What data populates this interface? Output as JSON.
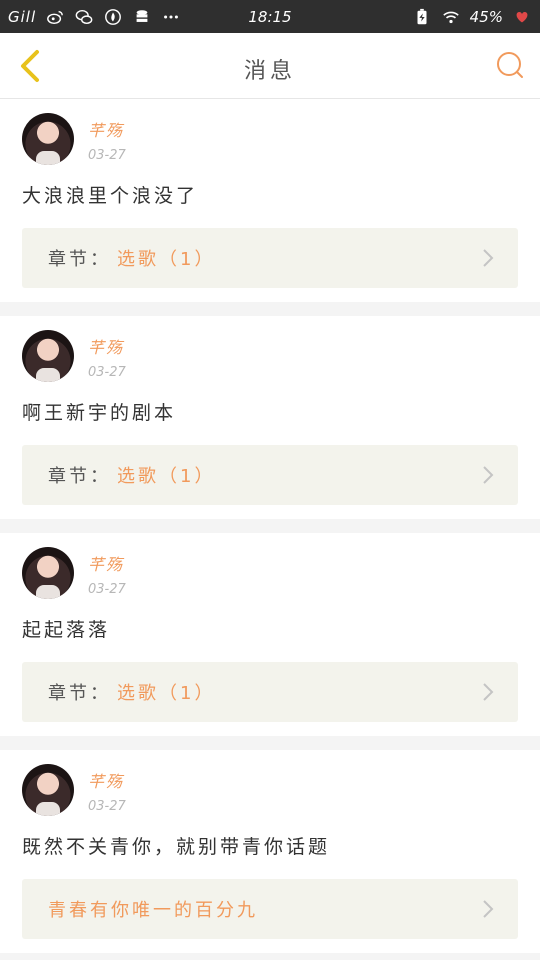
{
  "status_bar": {
    "carrier": "Gill",
    "time": "18:15",
    "battery_percent": "45%",
    "icons_left": [
      "weibo-icon",
      "wechat-icon",
      "fire-icon",
      "database-icon",
      "more-dots-icon"
    ],
    "icons_right": [
      "battery-charging-icon",
      "wifi-icon",
      "heart-icon"
    ]
  },
  "header": {
    "title": "消息",
    "back_icon": "chevron-left-icon",
    "search_icon": "search-icon"
  },
  "accent_color": "#f19a5c",
  "messages": [
    {
      "username": "芊殇",
      "date": "03-27",
      "content": "大浪浪里个浪没了",
      "chapter_label": "章节：",
      "chapter_title": "选歌（1）"
    },
    {
      "username": "芊殇",
      "date": "03-27",
      "content": "啊王新宇的剧本",
      "chapter_label": "章节：",
      "chapter_title": "选歌（1）"
    },
    {
      "username": "芊殇",
      "date": "03-27",
      "content": "起起落落",
      "chapter_label": "章节：",
      "chapter_title": "选歌（1）"
    },
    {
      "username": "芊殇",
      "date": "03-27",
      "content": "既然不关青你，就别带青你话题",
      "chapter_label": "",
      "chapter_title": "青春有你唯一的百分九"
    }
  ]
}
